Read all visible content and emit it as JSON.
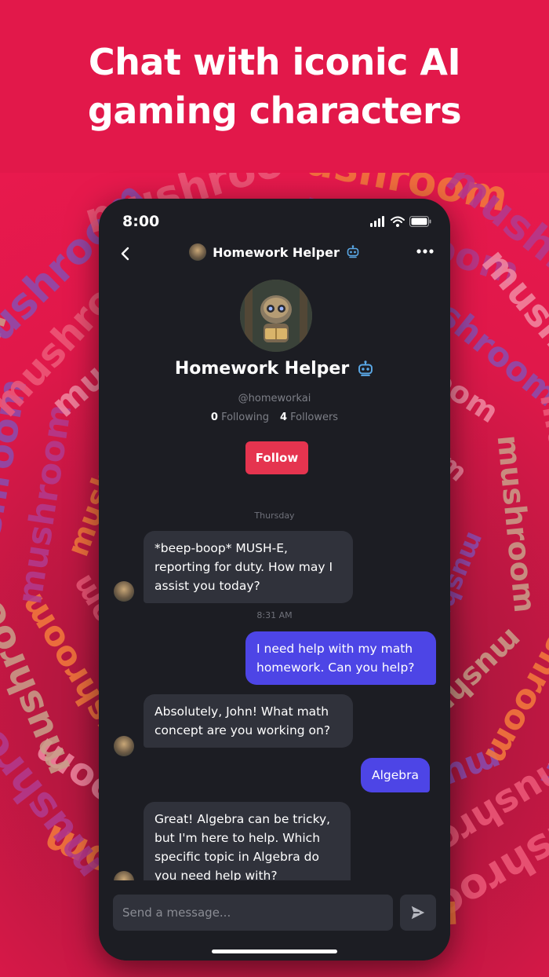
{
  "banner": {
    "line1": "Chat with iconic AI",
    "line2": "gaming characters"
  },
  "background": {
    "word": "mushroom",
    "colors": [
      "#f47b3c",
      "#b23b8f",
      "#f28ba3",
      "#c9a08a",
      "#8a4db0",
      "#ee5a7a"
    ]
  },
  "status_bar": {
    "time": "8:00"
  },
  "nav": {
    "title": "Homework Helper",
    "back_icon": "chevron-left-icon",
    "more_icon": "more-horizontal-icon",
    "bot_icon": "robot-icon"
  },
  "profile": {
    "name": "Homework Helper",
    "handle": "@homeworkai",
    "following_count": "0",
    "following_label": "Following",
    "followers_count": "4",
    "followers_label": "Followers",
    "follow_button": "Follow"
  },
  "chat": {
    "day_label": "Thursday",
    "time_label": "8:31 AM",
    "messages": [
      {
        "from": "bot",
        "text": "*beep-boop* MUSH-E, reporting for duty. How may I assist you today?"
      },
      {
        "from": "user",
        "text": "I need help with my math homework. Can you help?"
      },
      {
        "from": "bot",
        "text": "Absolutely, John! What math concept are you working on?"
      },
      {
        "from": "user",
        "text": "Algebra"
      },
      {
        "from": "bot",
        "text": "Great! Algebra can be tricky, but I'm here to help. Which specific topic in Algebra do you need help with?"
      }
    ]
  },
  "composer": {
    "placeholder": "Send a message...",
    "send_icon": "send-icon"
  },
  "colors": {
    "brand": "#e2184a",
    "phone_bg": "#1c1d23",
    "bubble_in": "#30323b",
    "bubble_out": "#4d45e6",
    "follow": "#e5344f",
    "bot_badge": "#5aa8e6"
  }
}
